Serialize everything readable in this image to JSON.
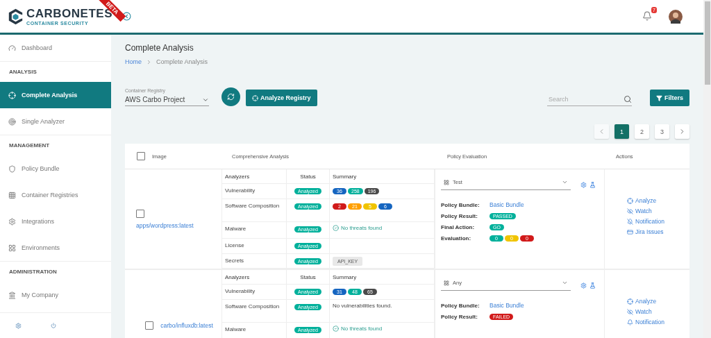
{
  "header": {
    "logo_title": "CARBONETES",
    "logo_subtitle": "CONTAINER SECURITY",
    "ribbon": "BETA",
    "notification_count": "7"
  },
  "sidebar": {
    "items": [
      {
        "kind": "item",
        "label": "Dashboard",
        "selected": false
      },
      {
        "kind": "section",
        "label": "ANALYSIS"
      },
      {
        "kind": "item",
        "label": "Complete Analysis",
        "selected": true
      },
      {
        "kind": "item",
        "label": "Single Analyzer",
        "selected": false
      },
      {
        "kind": "section",
        "label": "MANAGEMENT"
      },
      {
        "kind": "item",
        "label": "Policy Bundle",
        "selected": false
      },
      {
        "kind": "item",
        "label": "Container Registries",
        "selected": false
      },
      {
        "kind": "item",
        "label": "Integrations",
        "selected": false
      },
      {
        "kind": "item",
        "label": "Environments",
        "selected": false
      },
      {
        "kind": "section",
        "label": "ADMINISTRATION"
      },
      {
        "kind": "item",
        "label": "My Company",
        "selected": false
      }
    ]
  },
  "page": {
    "title": "Complete Analysis",
    "breadcrumb": [
      "Home",
      "Complete Analysis"
    ]
  },
  "toolbar": {
    "registry_label": "Container Registry",
    "registry_value": "AWS Carbo Project",
    "analyze_button": "Analyze Registry",
    "search_placeholder": "Search",
    "filters_button": "Filters"
  },
  "pagination": [
    {
      "label": "1",
      "selected": true
    },
    {
      "label": "2",
      "selected": false
    },
    {
      "label": "3",
      "selected": false
    }
  ],
  "table": {
    "select_all_checked": false,
    "columns": [
      "Image",
      "Comprehensive Analysis",
      "Policy Evaluation",
      "Actions"
    ],
    "rows": [
      {
        "checked": false,
        "image": "apps/wordpress:latest",
        "subheaders": [
          "Analyzers",
          "Status",
          "Summary"
        ],
        "analyzers": [
          {
            "name": "Vulnerability",
            "status": "Analyzed",
            "summary": {
              "kind": "pills",
              "pills": [
                {
                  "label": "36",
                  "color": "#1565c0"
                },
                {
                  "label": "258",
                  "color": "#00b09b"
                },
                {
                  "label": "196",
                  "color": "#4a4a4a"
                }
              ]
            }
          },
          {
            "name": "Software Composition",
            "status": "Analyzed",
            "summary": {
              "kind": "pills",
              "pills": [
                {
                  "label": "2",
                  "color": "#d11a1a"
                },
                {
                  "label": "21",
                  "color": "#ff9f00"
                },
                {
                  "label": "5",
                  "color": "#f0c400"
                },
                {
                  "label": "6",
                  "color": "#1565c0"
                }
              ]
            }
          },
          {
            "name": "Malware",
            "status": "Analyzed",
            "summary": {
              "kind": "ok",
              "text": "No threats found"
            }
          },
          {
            "name": "License",
            "status": "Analyzed"
          },
          {
            "name": "Secrets",
            "status": "Analyzed",
            "summary": {
              "kind": "tag",
              "text": "API_KEY"
            }
          }
        ],
        "policy": {
          "select": "Test",
          "fields": [
            {
              "label": "Policy Bundle:",
              "kind": "link",
              "value": "Basic Bundle"
            },
            {
              "label": "Policy Result:",
              "kind": "pills",
              "pills": [
                {
                  "label": "PASSED",
                  "color": "#00b09b"
                }
              ]
            },
            {
              "label": "Final Action:",
              "kind": "pills",
              "pills": [
                {
                  "label": "GO",
                  "color": "#00b09b"
                }
              ]
            },
            {
              "label": "Evaluation:",
              "kind": "pills",
              "pills": [
                {
                  "label": "0",
                  "color": "#00b09b"
                },
                {
                  "label": "0",
                  "color": "#f0c400"
                },
                {
                  "label": "0",
                  "color": "#d11a1a"
                }
              ]
            }
          ]
        },
        "actions": [
          {
            "kind": "analyze",
            "label": "Analyze"
          },
          {
            "kind": "watch-off",
            "label": "Watch"
          },
          {
            "kind": "notification-off",
            "label": "Notification"
          },
          {
            "kind": "jira",
            "label": "Jira Issues"
          }
        ]
      },
      {
        "checked": false,
        "image": "carbo/influxdb:latest",
        "subheaders": [
          "Analyzers",
          "Status",
          "Summary"
        ],
        "analyzers": [
          {
            "name": "Vulnerability",
            "status": "Analyzed",
            "summary": {
              "kind": "pills",
              "pills": [
                {
                  "label": "31",
                  "color": "#1565c0"
                },
                {
                  "label": "48",
                  "color": "#00b09b"
                },
                {
                  "label": "65",
                  "color": "#4a4a4a"
                }
              ]
            }
          },
          {
            "name": "Software Composition",
            "status": "Analyzed",
            "summary": {
              "kind": "text",
              "text": "No vulnerabilities found."
            }
          },
          {
            "name": "Malware",
            "status": "Analyzed",
            "summary": {
              "kind": "ok",
              "text": "No threats found"
            }
          }
        ],
        "policy": {
          "select": "Any",
          "fields": [
            {
              "label": "Policy Bundle:",
              "kind": "link",
              "value": "Basic Bundle"
            },
            {
              "label": "Policy Result:",
              "kind": "pills",
              "pills": [
                {
                  "label": "FAILED",
                  "color": "#d11a1a"
                }
              ]
            }
          ]
        },
        "actions": [
          {
            "kind": "analyze",
            "label": "Analyze"
          },
          {
            "kind": "watch-off",
            "label": "Watch"
          },
          {
            "kind": "notification",
            "label": "Notification"
          }
        ]
      }
    ]
  }
}
